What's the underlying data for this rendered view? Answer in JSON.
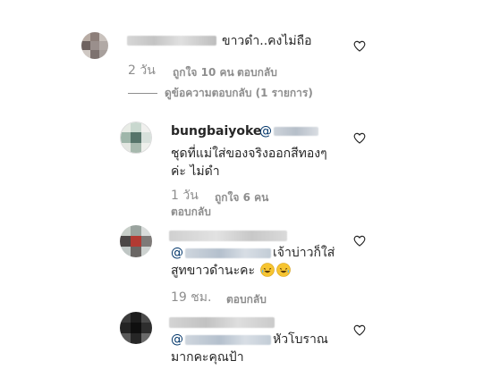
{
  "comments": [
    {
      "text": "ขาวดำ..คงไม่ถือ",
      "time": "2 วัน",
      "likes": "ถูกใจ 10 คน",
      "reply": "ตอบกลับ",
      "view_replies": "ดูข้อความตอบกลับ (1 รายการ)"
    },
    {
      "username": "bungbaiyoke",
      "mention": "@",
      "text_line1": "ชุดที่แม่ใส่ของจริงออกสีทองๆ",
      "text_line2": "ค่ะ ไม่ดำ",
      "time": "1 วัน",
      "likes": "ถูกใจ 6 คน",
      "reply": "ตอบกลับ"
    },
    {
      "mention": "@",
      "text_line1": "เจ้าบ่าวก็ใส่",
      "text_line2": "สูทขาวดำนะคะ",
      "emoji": "rolling-on-floor-laughing-emoji",
      "time": "19 ชม.",
      "reply": "ตอบกลับ"
    },
    {
      "mention": "@",
      "text_line1": "หัวโบราณ",
      "text_line2": "มากคะคุณป้า"
    }
  ],
  "icons": {
    "like": "heart-outline-icon"
  },
  "colors": {
    "text": "#262626",
    "meta": "#8e8e8e",
    "emoji": "#f7c531"
  }
}
